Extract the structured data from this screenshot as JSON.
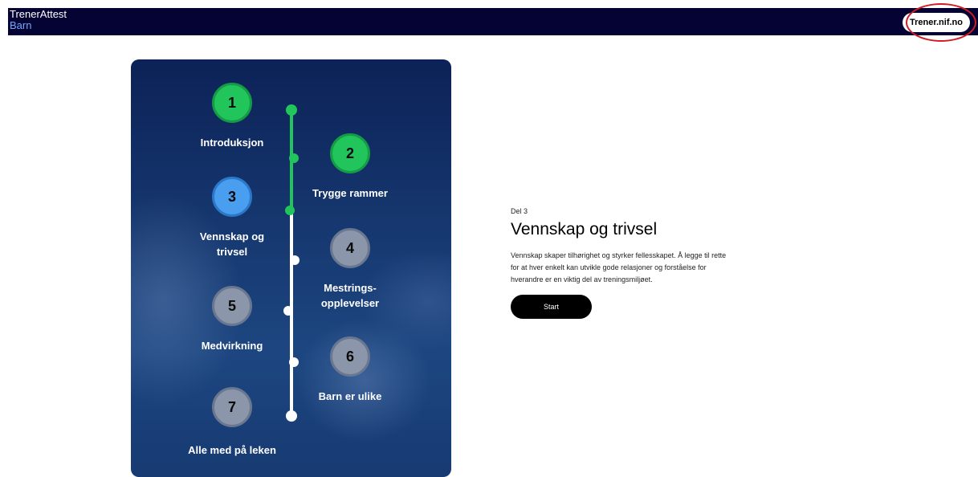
{
  "header": {
    "app_title": "TrenerAttest",
    "app_subtitle": "Barn",
    "external_link": "Trener.nif.no"
  },
  "steps": [
    {
      "number": "1",
      "label": "Introduksjon",
      "status": "completed"
    },
    {
      "number": "2",
      "label": "Trygge rammer",
      "status": "completed"
    },
    {
      "number": "3",
      "label": "Vennskap og trivsel",
      "status": "active"
    },
    {
      "number": "4",
      "label": "Mestrings-opplevelser",
      "status": "todo"
    },
    {
      "number": "5",
      "label": "Medvirkning",
      "status": "todo"
    },
    {
      "number": "6",
      "label": "Barn er ulike",
      "status": "todo"
    },
    {
      "number": "7",
      "label": "Alle med på leken",
      "status": "todo"
    }
  ],
  "progress": {
    "completed_steps": 2,
    "total_steps": 7
  },
  "detail": {
    "part_label": "Del 3",
    "title": "Vennskap og trivsel",
    "description": "Vennskap skaper tilhørighet og styrker fellesskapet. Å legge til rette for at hver enkelt kan utvikle gode relasjoner og forståelse for hverandre er en viktig del av treningsmiljøet.",
    "start_label": "Start"
  },
  "colors": {
    "header_bg": "#040333",
    "completed": "#22c45c",
    "active": "#4a9ef0",
    "todo": "#8b96ab",
    "annotation": "#d01c22"
  }
}
